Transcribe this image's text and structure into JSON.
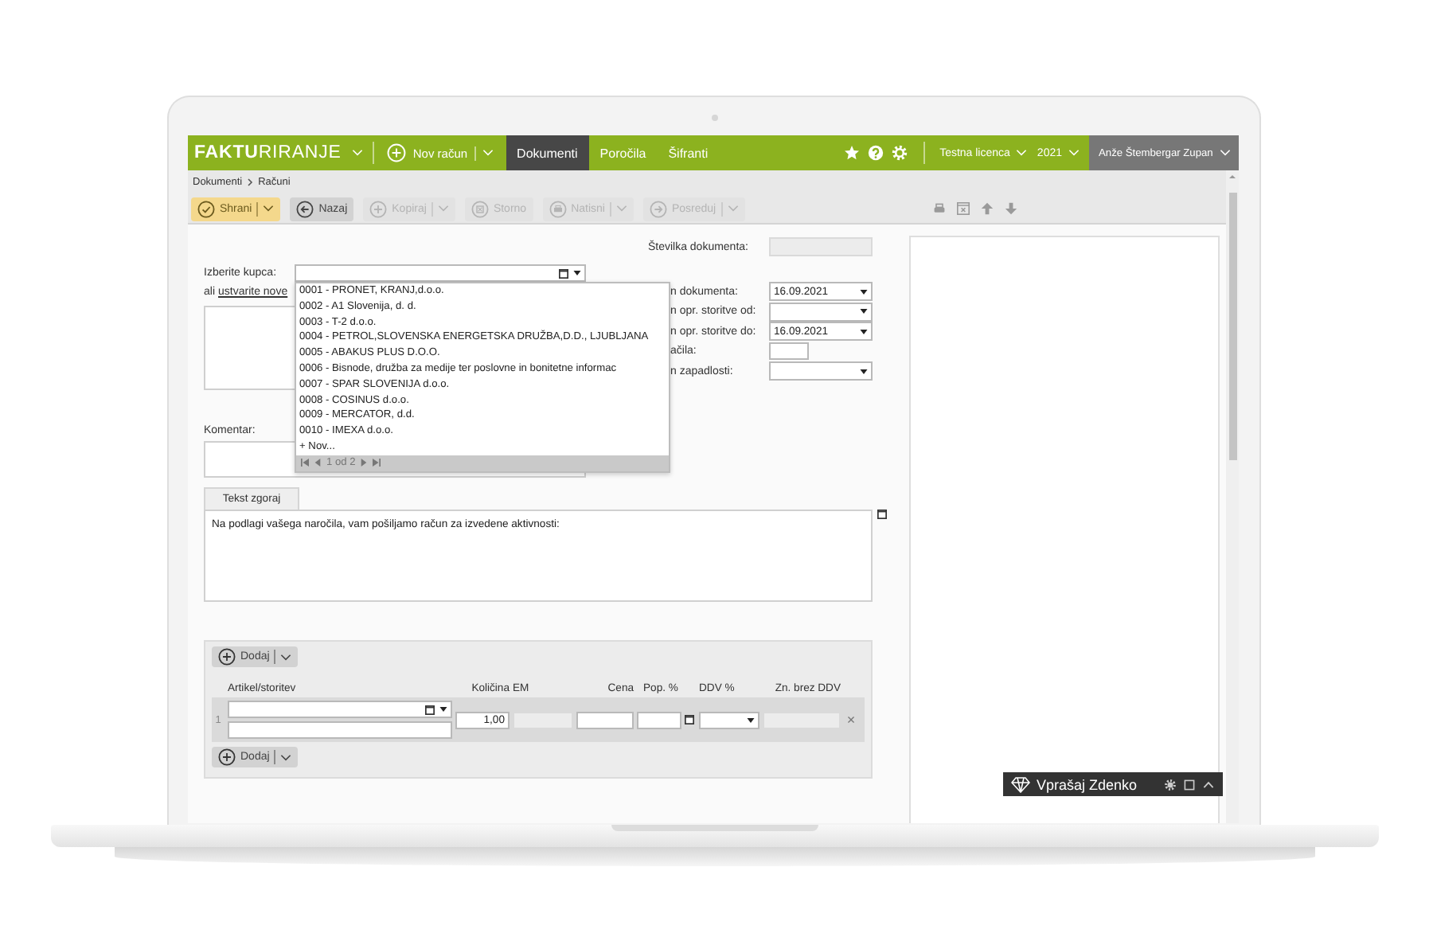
{
  "topbar": {
    "logo": "**FAKTU**RIRANJE",
    "new_button": "Nov račun",
    "nav": [
      {
        "label": "Dokumenti",
        "selected": true
      },
      {
        "label": "Poročila",
        "selected": false
      },
      {
        "label": "Šifranti",
        "selected": false
      }
    ],
    "license": "Testna licenca",
    "year": "2021",
    "user": "Anže Štembergar Zupan"
  },
  "breadcrumb": [
    "Dokumenti",
    "Računi"
  ],
  "toolbar": [
    {
      "label": "Shrani",
      "kind": "primary",
      "menu": true,
      "disabled": false
    },
    {
      "label": "Nazaj",
      "kind": "normal",
      "menu": false,
      "disabled": false
    },
    {
      "label": "Kopiraj",
      "kind": "normal",
      "menu": true,
      "disabled": true
    },
    {
      "label": "Storno",
      "kind": "normal",
      "menu": false,
      "disabled": true
    },
    {
      "label": "Natisni",
      "kind": "normal",
      "menu": true,
      "disabled": true
    },
    {
      "label": "Posreduj",
      "kind": "normal",
      "menu": true,
      "disabled": true
    }
  ],
  "form": {
    "document_number_label": "Številka dokumenta:",
    "customer_label": "Izberite kupca:",
    "alt_prefix": "ali",
    "alt_link": "ustvarite nove",
    "comment_label": "Komentar:",
    "date_fields": [
      {
        "label": "n dokumenta:",
        "kind": "select",
        "value": "16.09.2021"
      },
      {
        "label": "n opr. storitve od:",
        "kind": "select"
      },
      {
        "label": "n opr. storitve do:",
        "kind": "select",
        "value": "16.09.2021"
      },
      {
        "label": "ačila:",
        "kind": "input"
      },
      {
        "label": "n zapadlosti:",
        "kind": "select"
      }
    ]
  },
  "customer_dropdown": {
    "options": [
      "0001 - PRONET, KRANJ,d.o.o.",
      "0002 - A1 Slovenija, d. d.",
      "0003 - T-2 d.o.o.",
      "0004 - PETROL,SLOVENSKA ENERGETSKA DRUŽBA,D.D., LJUBLJANA",
      "0005 - ABAKUS PLUS D.O.O.",
      "0006 - Bisnode, družba za medije ter poslovne in bonitetne informac",
      "0007 - SPAR SLOVENIJA d.o.o.",
      "0008 - COSINUS d.o.o.",
      "0009 - MERCATOR, d.d.",
      "0010 - IMEXA d.o.o."
    ],
    "new_option": "+ Nov...",
    "pager": "1 od 2"
  },
  "top_text": {
    "tab": "Tekst zgoraj",
    "value": "Na podlagi vašega naročila, vam pošiljamo račun za izvedene aktivnosti:"
  },
  "items": {
    "add_buttons": [
      "Dodaj",
      "Dodaj"
    ],
    "columns": [
      "Artikel/storitev",
      "Količina",
      "EM",
      "Cena",
      "Pop. %",
      "DDV %",
      "Zn. brez DDV"
    ],
    "rows": [
      {
        "number": "1",
        "quantity": "1,00",
        "remove": "×"
      }
    ]
  },
  "chat": {
    "title": "Vprašaj Zdenko"
  }
}
